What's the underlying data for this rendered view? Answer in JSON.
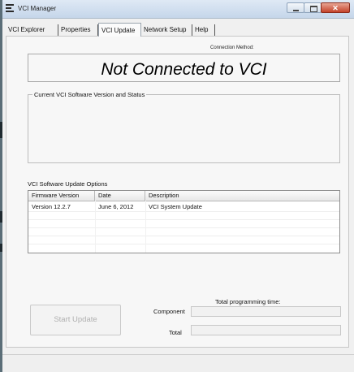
{
  "window": {
    "title": "VCI Manager",
    "icons": {
      "app": "list-icon",
      "minimize": "minimize-icon",
      "maximize": "maximize-icon",
      "close": "close-icon"
    }
  },
  "tabs": [
    {
      "label": "VCI Explorer",
      "active": false
    },
    {
      "label": "Properties",
      "active": false
    },
    {
      "label": "VCI Update",
      "active": true
    },
    {
      "label": "Network Setup",
      "active": false
    },
    {
      "label": "Help",
      "active": false
    }
  ],
  "connection": {
    "label": "Connection Method:",
    "status": "Not Connected to VCI"
  },
  "current_version_group": {
    "title": "Current VCI Software Version and Status"
  },
  "updates": {
    "label": "VCI Software Update Options",
    "columns": [
      "Firmware Version",
      "Date",
      "Description"
    ],
    "rows": [
      {
        "firmware": "Version 12.2.7",
        "date": "June 6, 2012",
        "description": "VCI System Update"
      }
    ]
  },
  "actions": {
    "start_update": "Start Update",
    "start_update_enabled": false
  },
  "programming": {
    "title": "Total programming time:",
    "component_label": "Component",
    "total_label": "Total"
  }
}
